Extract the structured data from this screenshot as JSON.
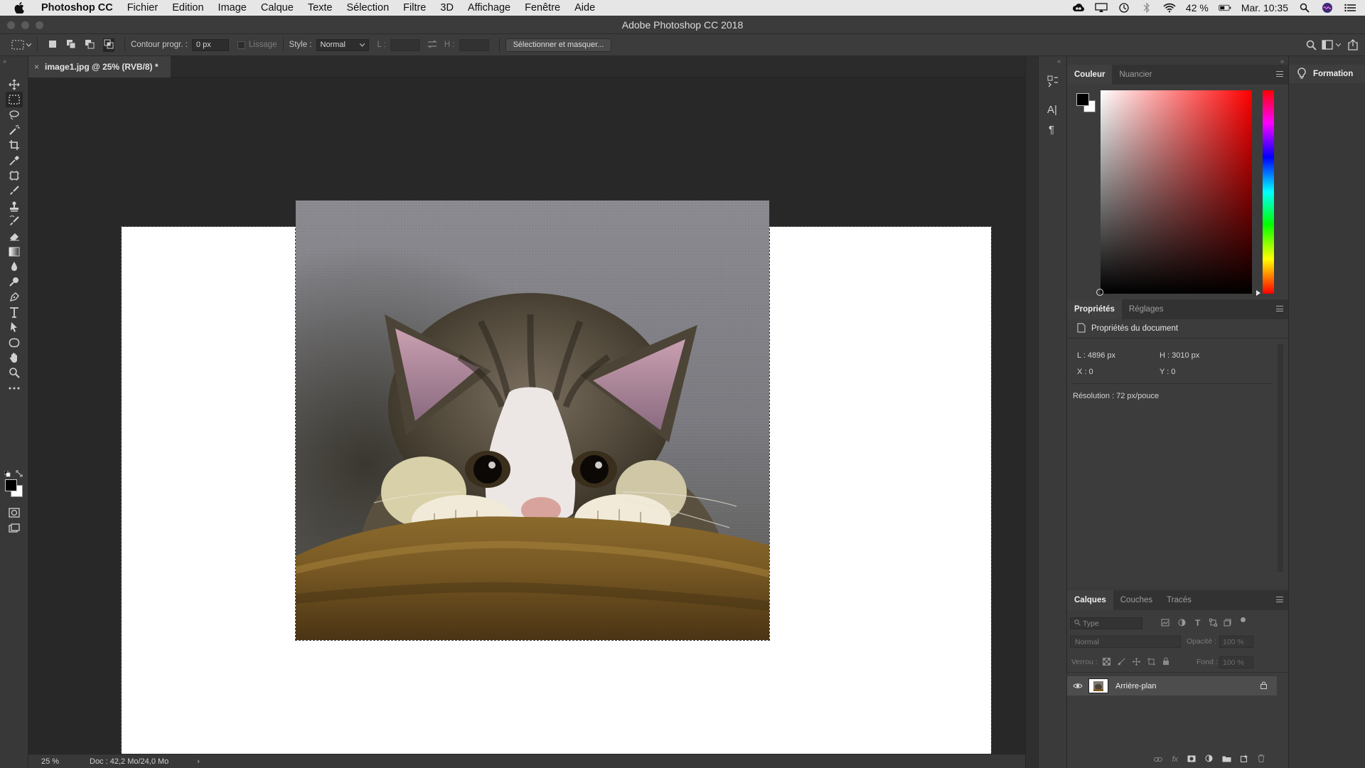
{
  "menubar": {
    "app_name": "Photoshop CC",
    "items": [
      "Fichier",
      "Edition",
      "Image",
      "Calque",
      "Texte",
      "Sélection",
      "Filtre",
      "3D",
      "Affichage",
      "Fenêtre",
      "Aide"
    ],
    "battery": "42 %",
    "clock": "Mar. 10:35"
  },
  "window": {
    "title": "Adobe Photoshop CC 2018"
  },
  "options": {
    "feather_label": "Contour progr. :",
    "feather_value": "0 px",
    "antialias_label": "Lissage",
    "style_label": "Style :",
    "style_value": "Normal",
    "width_label": "L :",
    "height_label": "H :",
    "select_mask_button": "Sélectionner et masquer..."
  },
  "document": {
    "tab_label": "image1.jpg @ 25% (RVB/8) *",
    "zoom": "25 %",
    "doc_info": "Doc : 42,2 Mo/24,0 Mo"
  },
  "color_panel": {
    "tabs": [
      "Couleur",
      "Nuancier"
    ],
    "foreground": "#000000",
    "background": "#ffffff",
    "hue_color": "#ff0000"
  },
  "properties_panel": {
    "tabs": [
      "Propriétés",
      "Réglages"
    ],
    "header": "Propriétés du document",
    "width": "L : 4896 px",
    "height": "H : 3010 px",
    "x": "X : 0",
    "y": "Y : 0",
    "resolution": "Résolution : 72 px/pouce"
  },
  "layers_panel": {
    "tabs": [
      "Calques",
      "Couches",
      "Tracés"
    ],
    "filter_placeholder": "Type",
    "blend_mode": "Normal",
    "opacity_label": "Opacité :",
    "opacity_value": "100 %",
    "lock_label": "Verrou :",
    "fill_label": "Fond :",
    "fill_value": "100 %",
    "layers": [
      {
        "name": "Arrière-plan",
        "visible": true,
        "locked": true
      }
    ]
  },
  "learn_panel": {
    "label": "Formation"
  }
}
